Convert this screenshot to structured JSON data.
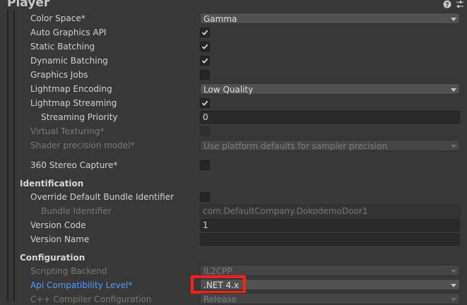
{
  "title": "Player",
  "colors": {
    "accent_blue": "#4f9fff",
    "highlight_red": "#ff1e1e"
  },
  "rendering": {
    "color_space": {
      "label": "Color Space*",
      "value": "Gamma"
    },
    "auto_graphics_api": {
      "label": "Auto Graphics API",
      "checked": true
    },
    "static_batching": {
      "label": "Static Batching",
      "checked": true
    },
    "dynamic_batching": {
      "label": "Dynamic Batching",
      "checked": true
    },
    "graphics_jobs": {
      "label": "Graphics Jobs",
      "checked": false
    },
    "lightmap_encoding": {
      "label": "Lightmap Encoding",
      "value": "Low Quality"
    },
    "lightmap_streaming": {
      "label": "Lightmap Streaming",
      "checked": true
    },
    "streaming_priority": {
      "label": "Streaming Priority",
      "value": "0"
    },
    "virtual_texturing": {
      "label": "Virtual Texturing*",
      "checked": false
    },
    "shader_precision": {
      "label": "Shader precision model*",
      "value": "Use platform defaults for sampler precision"
    },
    "stereo_capture": {
      "label": "360 Stereo Capture*",
      "checked": false
    }
  },
  "identification": {
    "header": "Identification",
    "override_bundle": {
      "label": "Override Default Bundle Identifier",
      "checked": false
    },
    "bundle_identifier": {
      "label": "Bundle Identifier",
      "value": "com.DefaultCompany.DokodemoDoor1"
    },
    "version_code": {
      "label": "Version Code",
      "value": "1"
    },
    "version_name": {
      "label": "Version Name",
      "value": ""
    }
  },
  "configuration": {
    "header": "Configuration",
    "scripting_backend": {
      "label": "Scripting Backend",
      "value": "IL2CPP"
    },
    "api_compat": {
      "label": "Api Compatibility Level*",
      "value": ".NET 4.x"
    },
    "cpp_compiler": {
      "label": "C++ Compiler Configuration",
      "value": "Release"
    }
  }
}
